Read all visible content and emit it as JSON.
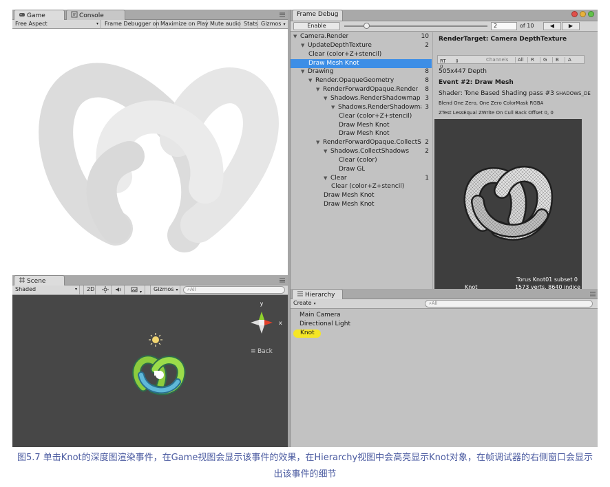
{
  "game": {
    "tabs": [
      {
        "label": "Game",
        "icon": "game-controller-icon"
      },
      {
        "label": "Console",
        "icon": "console-icon"
      }
    ],
    "toolbar": {
      "aspect": "Free Aspect",
      "frame_debugger": "Frame Debugger on",
      "maximize": "Maximize on Play",
      "mute": "Mute audio",
      "stats": "Stats",
      "gizmos": "Gizmos"
    },
    "tab_menu_icon": "panel-menu-icon"
  },
  "scene": {
    "tab": {
      "label": "Scene",
      "icon": "grid-icon"
    },
    "toolbar": {
      "shading": "Shaded",
      "mode_2d": "2D",
      "lighting_icon": "sun-icon",
      "audio_icon": "speaker-icon",
      "effects_icon": "image-icon",
      "gizmos": "Gizmos",
      "search": "All"
    },
    "gizmo": {
      "y": "y",
      "x": "x",
      "back": "Back"
    }
  },
  "frame_debug": {
    "tab": "Frame Debug",
    "enable_button": "Enable",
    "slider_value": 0.14,
    "current_event": "2",
    "of_label": "of 10",
    "window_colors": [
      "#e0504a",
      "#e8b23c",
      "#62c24a"
    ],
    "tree": [
      {
        "label": "Camera.Render",
        "count": "10",
        "indent": 0,
        "expanded": true
      },
      {
        "label": "UpdateDepthTexture",
        "count": "2",
        "indent": 1,
        "expanded": true
      },
      {
        "label": "Clear (color+Z+stencil)",
        "count": "",
        "indent": 2,
        "expanded": false
      },
      {
        "label": "Draw Mesh Knot",
        "count": "",
        "indent": 2,
        "expanded": false,
        "selected": true
      },
      {
        "label": "Drawing",
        "count": "8",
        "indent": 1,
        "expanded": true
      },
      {
        "label": "Render.OpaqueGeometry",
        "count": "8",
        "indent": 2,
        "expanded": true
      },
      {
        "label": "RenderForwardOpaque.Render",
        "count": "8",
        "indent": 3,
        "expanded": true
      },
      {
        "label": "Shadows.RenderShadowmap",
        "count": "3",
        "indent": 4,
        "expanded": true
      },
      {
        "label": "Shadows.RenderShadowmapC",
        "count": "3",
        "indent": 5,
        "expanded": true
      },
      {
        "label": "Clear (color+Z+stencil)",
        "count": "",
        "indent": 6,
        "expanded": false
      },
      {
        "label": "Draw Mesh Knot",
        "count": "",
        "indent": 6,
        "expanded": false
      },
      {
        "label": "Draw Mesh Knot",
        "count": "",
        "indent": 6,
        "expanded": false
      },
      {
        "label": "RenderForwardOpaque.CollectSl",
        "count": "2",
        "indent": 3,
        "expanded": true
      },
      {
        "label": "Shadows.CollectShadows",
        "count": "2",
        "indent": 4,
        "expanded": true
      },
      {
        "label": "Clear (color)",
        "count": "",
        "indent": 6,
        "expanded": false
      },
      {
        "label": "Draw GL",
        "count": "",
        "indent": 6,
        "expanded": false
      },
      {
        "label": "Clear",
        "count": "1",
        "indent": 4,
        "expanded": true
      },
      {
        "label": "Clear (color+Z+stencil)",
        "count": "",
        "indent": 5,
        "expanded": false
      },
      {
        "label": "Draw Mesh Knot",
        "count": "",
        "indent": 4,
        "expanded": false
      },
      {
        "label": "Draw Mesh Knot",
        "count": "",
        "indent": 4,
        "expanded": false
      }
    ],
    "detail": {
      "render_target": "RenderTarget: Camera DepthTexture",
      "rt_select": "RT 0",
      "channels": "Channels",
      "channel_buttons": [
        "All",
        "R",
        "G",
        "B",
        "A"
      ],
      "depth": "505x447 Depth",
      "event": "Event #2: Draw Mesh",
      "shader": "Shader: Tone Based Shading pass #3",
      "shader_keyword": "SHADOWS_DE",
      "blend": "Blend One Zero, One Zero ColorMask RGBA",
      "ztest": "ZTest LessEqual ZWrite On Cull Back Offset 0, 0",
      "preview_label": "Knot",
      "preview_subset": "Torus Knot01 subset 0",
      "preview_stats": "1573 verts, 8640 indice"
    }
  },
  "hierarchy": {
    "tab": {
      "label": "Hierarchy",
      "icon": "list-icon"
    },
    "create": "Create",
    "search": "All",
    "items": [
      {
        "label": "Main Camera",
        "highlight": false
      },
      {
        "label": "Directional Light",
        "highlight": false
      },
      {
        "label": "Knot",
        "highlight": true
      }
    ],
    "highlight_color": "#f5e626"
  },
  "caption": "图5.7 单击Knot的深度图渲染事件，在Game视图会显示该事件的效果，在Hierarchy视图中会高亮显示Knot对象，在帧调试器的右侧窗口会显示出该事件的细节"
}
